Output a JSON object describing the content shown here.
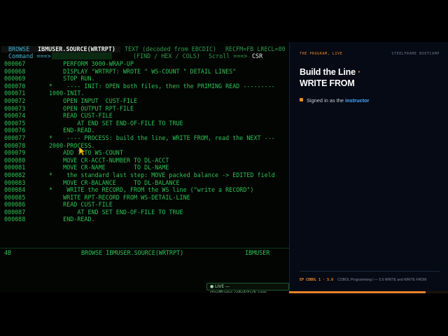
{
  "terminal": {
    "mode": "BROWSE",
    "dataset": "IBMUSER.SOURCE(WRTRPT)",
    "text_mode": "TEXT (decoded from EBCDIC)",
    "record_info": "RECFM=FB LRECL=80",
    "command_label": "Command ===>",
    "command_value": "",
    "options": "(FIND / HEX / COLS)",
    "scroll_label": "Scroll ===>",
    "scroll_value": "CSR",
    "lines": [
      {
        "num": "000067",
        "text": "    PERFORM 3000-WRAP-UP"
      },
      {
        "num": "000068",
        "text": "    DISPLAY \"WRTRPT: WROTE \" WS-COUNT \" DETAIL LINES\""
      },
      {
        "num": "000069",
        "text": "    STOP RUN."
      },
      {
        "num": "000070",
        "text": "*    ---- INIT: OPEN both files, then the PRIMING READ ---------"
      },
      {
        "num": "000071",
        "text": "1000-INIT."
      },
      {
        "num": "000072",
        "text": "    OPEN INPUT  CUST-FILE"
      },
      {
        "num": "000073",
        "text": "    OPEN OUTPUT RPT-FILE"
      },
      {
        "num": "000074",
        "text": "    READ CUST-FILE"
      },
      {
        "num": "000075",
        "text": "        AT END SET END-OF-FILE TO TRUE"
      },
      {
        "num": "000076",
        "text": "    END-READ."
      },
      {
        "num": "000077",
        "text": "*    ---- PROCESS: build the line, WRITE FROM, read the NEXT ---"
      },
      {
        "num": "000078",
        "text": "2000-PROCESS."
      },
      {
        "num": "000079",
        "text": "    ADD 1 TO WS-COUNT"
      },
      {
        "num": "000080",
        "text": "    MOVE CR-ACCT-NUMBER TO DL-ACCT"
      },
      {
        "num": "000081",
        "text": "    MOVE CR-NAME        TO DL-NAME"
      },
      {
        "num": "000082",
        "text": "*    the standard last step: MOVE packed balance -> EDITED field"
      },
      {
        "num": "000083",
        "text": "    MOVE CR-BALANCE     TO DL-BALANCE"
      },
      {
        "num": "000084",
        "text": "*    WRITE the RECORD, FROM the WS line (\"write a RECORD\")"
      },
      {
        "num": "000085",
        "text": "    WRITE RPT-RECORD FROM WS-DETAIL-LINE"
      },
      {
        "num": "000086",
        "text": "    READ CUST-FILE"
      },
      {
        "num": "000087",
        "text": "        AT END SET END-OF-FILE TO TRUE"
      },
      {
        "num": "000088",
        "text": "    END-READ."
      }
    ],
    "footer": {
      "left": "4B",
      "center": "BROWSE IBMUSER.SOURCE(WRTRPT)",
      "right": "IBMUSER"
    },
    "live_badge": "● LIVE — steelframe.cobolstack.com"
  },
  "panel": {
    "kicker_left": "THE PROGRAM, LIVE",
    "kicker_right": "STEELFRAME BOOTCAMP",
    "title_line1": "Build the Line",
    "title_dot": "·",
    "title_line2": "WRITE FROM",
    "signin_prefix": "Signed in as the ",
    "signin_role": "instructor",
    "footer_code": "EP COBOL 1 · 5.6",
    "footer_text": "COBOL Programming I — 5.6 WRITE and WRITE FROM"
  },
  "progress": 0.86,
  "colors": {
    "terminal_green": "#2ec254",
    "accent_orange": "#f08a2a",
    "accent_blue": "#4aa7ff"
  }
}
